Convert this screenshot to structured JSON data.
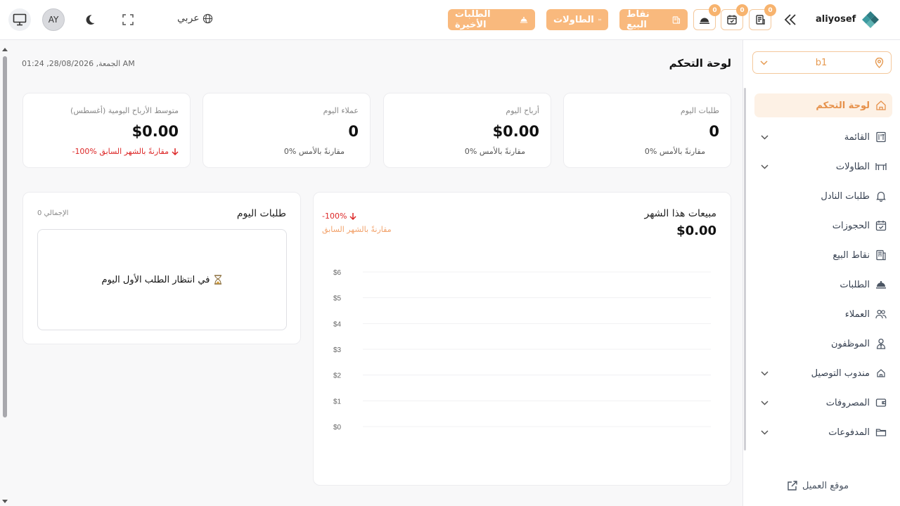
{
  "topbar": {
    "avatar_initials": "AY",
    "language_label": "عربي",
    "recent_orders_label": "الطلبات الأخيرة",
    "tables_label": "الطاولات",
    "pos_label": "نقاط البيع",
    "badges": [
      "0",
      "0",
      "0"
    ],
    "username": "aliyosef"
  },
  "sidebar": {
    "branch": "b1",
    "items": [
      {
        "label": "لوحة التحكم",
        "icon": "home-icon",
        "active": true,
        "expandable": false
      },
      {
        "label": "القائمة",
        "icon": "menu-icon",
        "active": false,
        "expandable": true
      },
      {
        "label": "الطاولات",
        "icon": "table-icon",
        "active": false,
        "expandable": true
      },
      {
        "label": "طلبات النادل",
        "icon": "bell-icon",
        "active": false,
        "expandable": false
      },
      {
        "label": "الحجوزات",
        "icon": "calendar-check-icon",
        "active": false,
        "expandable": false
      },
      {
        "label": "نقاط البيع",
        "icon": "pos-icon",
        "active": false,
        "expandable": false
      },
      {
        "label": "الطلبات",
        "icon": "cloche-icon",
        "active": false,
        "expandable": false
      },
      {
        "label": "العملاء",
        "icon": "users-icon",
        "active": false,
        "expandable": false
      },
      {
        "label": "الموظفون",
        "icon": "staff-icon",
        "active": false,
        "expandable": false
      },
      {
        "label": "مندوب التوصيل",
        "icon": "delivery-icon",
        "active": false,
        "expandable": true
      },
      {
        "label": "المصروفات",
        "icon": "wallet-icon",
        "active": false,
        "expandable": true
      },
      {
        "label": "المدفوعات",
        "icon": "folder-icon",
        "active": false,
        "expandable": true
      }
    ],
    "customer_site": "موقع العميل"
  },
  "main": {
    "page_title": "لوحة التحكم",
    "datetime": "الجمعة, 28/08/2026, 01:24 AM",
    "stats": [
      {
        "label": "طلبات اليوم",
        "value": "0",
        "compare": "0% مقارنةً بالأمس"
      },
      {
        "label": "أرباح اليوم",
        "value": "$0.00",
        "compare": "0% مقارنةً بالأمس"
      },
      {
        "label": "عملاء اليوم",
        "value": "0",
        "compare": "0% مقارنةً بالأمس"
      },
      {
        "label": "متوسط الأرباح اليومية (أغسطس)",
        "value": "$0.00",
        "compare": "-100% مقارنةً بالشهر السابق"
      }
    ],
    "monthly_sales": {
      "title": "مبيعات هذا الشهر",
      "value": "$0.00",
      "change": "-100%",
      "compare": "مقارنةً بالشهر السابق"
    },
    "today_orders": {
      "title": "طلبات اليوم",
      "total": "0 الإجمالي",
      "empty_message": "في انتظار الطلب الأول اليوم"
    }
  },
  "chart_data": {
    "type": "line",
    "title": "مبيعات هذا الشهر",
    "y_ticks": [
      "$0",
      "$1",
      "$2",
      "$3",
      "$4",
      "$5",
      "$6"
    ],
    "ylim": [
      0,
      6
    ],
    "x": [],
    "series": [],
    "grid": true
  },
  "colors": {
    "accent": "#f9b97d",
    "accent_text": "#e6914b",
    "danger": "#dc2626"
  }
}
